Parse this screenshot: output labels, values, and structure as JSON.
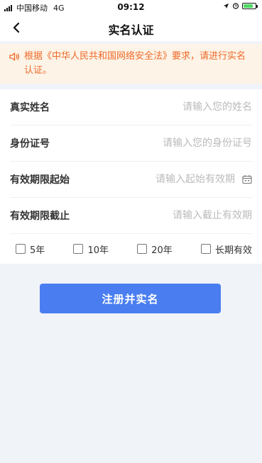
{
  "status_bar": {
    "carrier": "中国移动",
    "network": "4G",
    "time": "09:12"
  },
  "header": {
    "title": "实名认证"
  },
  "notice": {
    "text": "根据《中华人民共和国网络安全法》要求，请进行实名认证。"
  },
  "form": {
    "fields": [
      {
        "label": "真实姓名",
        "placeholder": "请输入您的姓名",
        "value": ""
      },
      {
        "label": "身份证号",
        "placeholder": "请输入您的身份证号",
        "value": ""
      },
      {
        "label": "有效期限起始",
        "placeholder": "请输入起始有效期",
        "value": ""
      },
      {
        "label": "有效期限截止",
        "placeholder": "请输入截止有效期",
        "value": ""
      }
    ],
    "validity_options": [
      "5年",
      "10年",
      "20年",
      "长期有效"
    ]
  },
  "submit": {
    "label": "注册并实名"
  },
  "colors": {
    "primary": "#4a7ef0",
    "notice_text": "#ee6a2a",
    "notice_bg": "#fdf3e6",
    "page_bg": "#f0f3f8"
  },
  "icons": [
    "back-arrow-icon",
    "speaker-icon",
    "calendar-icon",
    "location-arrow-icon",
    "alarm-icon",
    "battery-icon"
  ]
}
